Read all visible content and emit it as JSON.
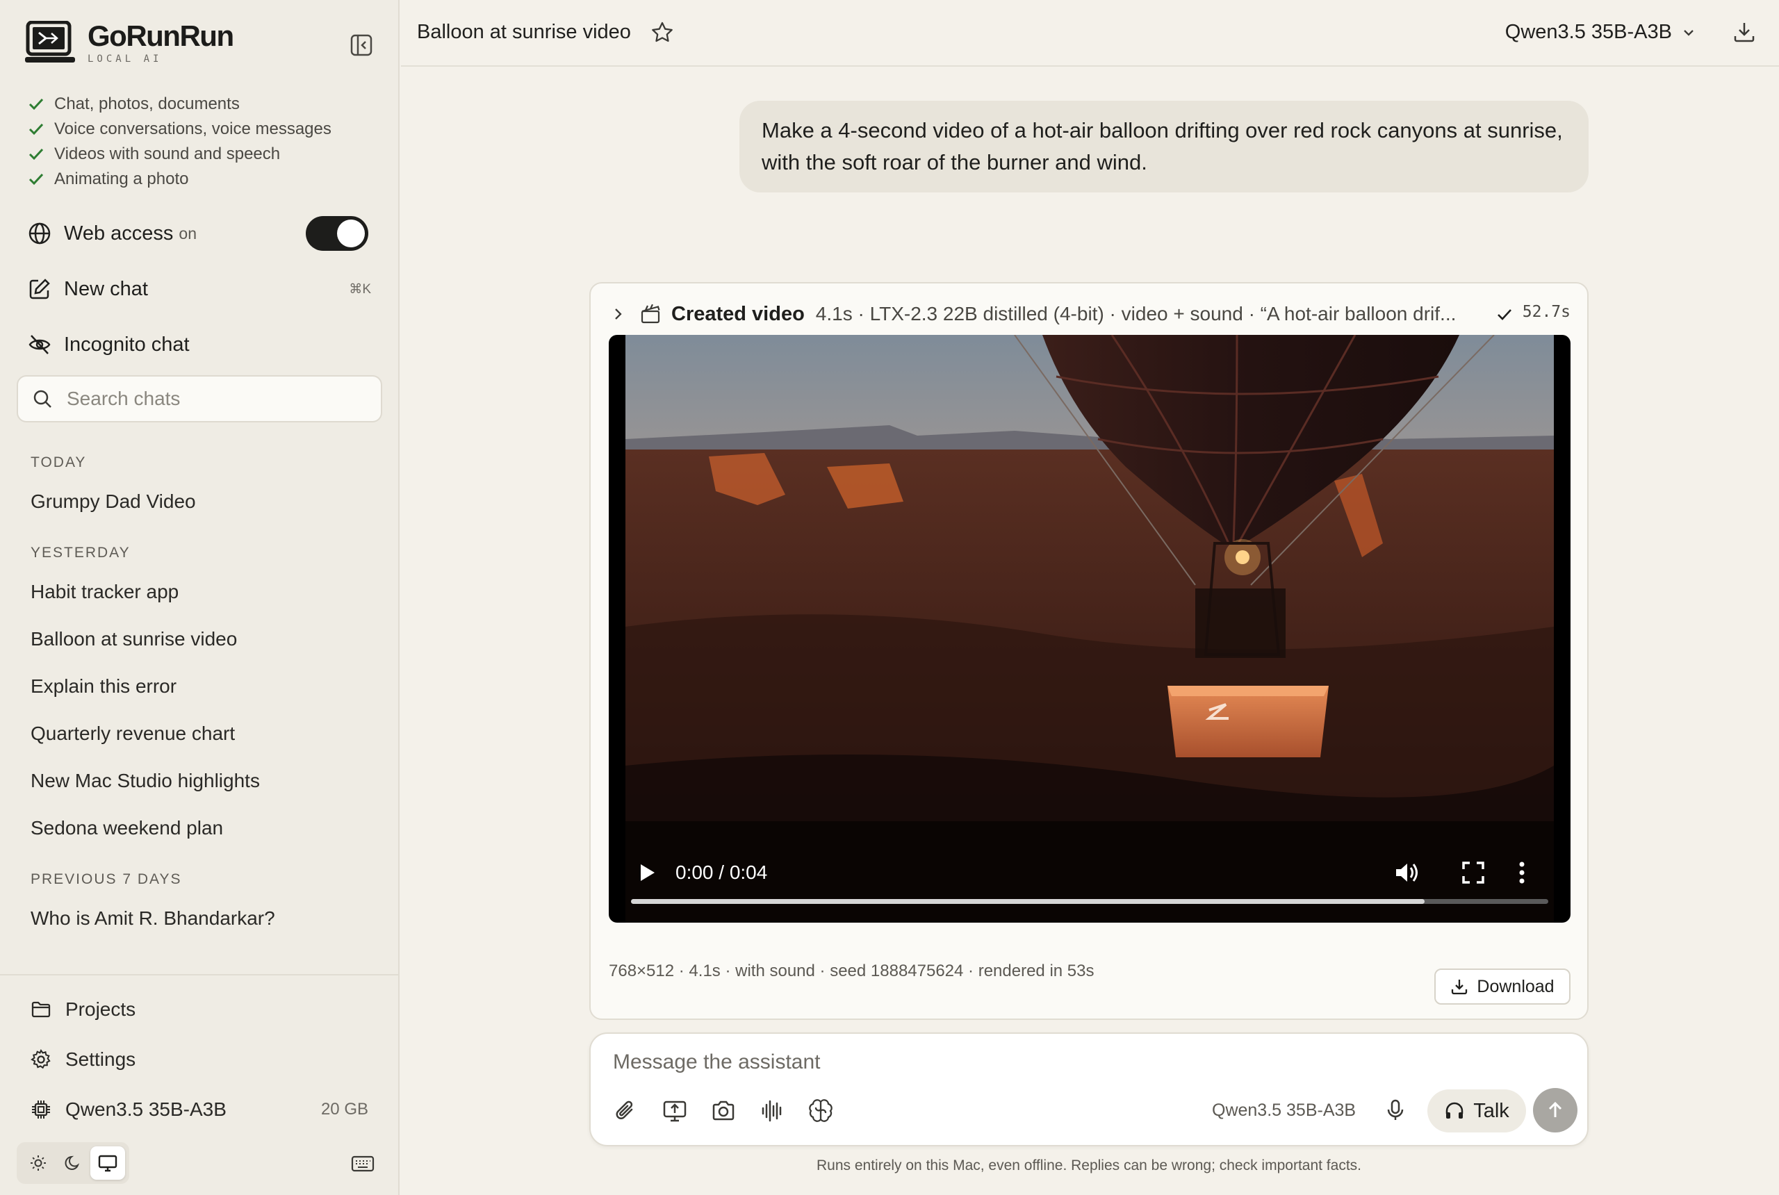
{
  "brand": {
    "name": "GoRunRun",
    "tagline": "LOCAL AI"
  },
  "sidebar": {
    "features": [
      "Chat, photos, documents",
      "Voice conversations, voice messages",
      "Videos with sound and speech",
      "Animating a photo"
    ],
    "web_access": {
      "label": "Web access",
      "state": "on",
      "enabled": true
    },
    "new_chat": {
      "label": "New chat",
      "shortcut": "⌘K"
    },
    "incognito": {
      "label": "Incognito chat"
    },
    "search": {
      "placeholder": "Search chats"
    },
    "sections": [
      {
        "heading": "TODAY",
        "items": [
          "Grumpy Dad Video"
        ]
      },
      {
        "heading": "YESTERDAY",
        "items": [
          "Habit tracker app",
          "Balloon at sunrise video",
          "Explain this error",
          "Quarterly revenue chart",
          "New Mac Studio highlights",
          "Sedona weekend plan"
        ]
      },
      {
        "heading": "PREVIOUS 7 DAYS",
        "items": [
          "Who is Amit R. Bhandarkar?"
        ]
      }
    ],
    "bottom": {
      "projects": "Projects",
      "settings": "Settings",
      "model": {
        "name": "Qwen3.5 35B-A3B",
        "size": "20 GB"
      }
    },
    "theme": {
      "options": [
        "light",
        "dark",
        "system"
      ],
      "active": "system"
    }
  },
  "header": {
    "title": "Balloon at sunrise video",
    "model": "Qwen3.5 35B-A3B"
  },
  "messages": {
    "user": "Make a 4-second video of a hot-air balloon drifting over red rock canyons at sunrise, with the soft roar of the burner and wind.",
    "result": {
      "label": "Created video",
      "meta": "4.1s · LTX-2.3 22B distilled (4-bit) · video + sound · “A hot-air balloon drif...",
      "elapsed": "52.7s",
      "video": {
        "time": "0:00 / 0:04",
        "progress": 0.865
      },
      "footer": "768×512 · 4.1s · with sound · seed 1888475624 · rendered in 53s",
      "download": "Download"
    }
  },
  "composer": {
    "placeholder": "Message the assistant",
    "model": "Qwen3.5 35B-A3B",
    "talk": "Talk"
  },
  "disclaimer": "Runs entirely on this Mac, even offline. Replies can be wrong; check important facts.",
  "colors": {
    "background": "#f4f1ea",
    "sidebar": "#efece4",
    "accent_check": "#2e7d32",
    "toggle_on": "#1d1d1b"
  }
}
